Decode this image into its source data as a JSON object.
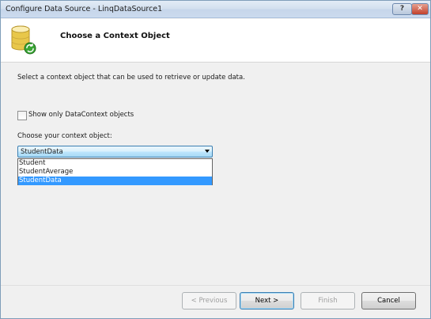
{
  "window": {
    "title": "Configure Data Source - LinqDataSource1",
    "help_label": "?",
    "close_label": "✕"
  },
  "header": {
    "icon": "database-icon",
    "heading": "Choose a Context Object"
  },
  "content": {
    "description": "Select a context object that can be used to retrieve or update data.",
    "checkbox": {
      "label": "Show only DataContext objects",
      "checked": false
    },
    "choose_label": "Choose your context object:",
    "select": {
      "value": "StudentData",
      "options": [
        "Student",
        "StudentAverage",
        "StudentData"
      ]
    }
  },
  "footer": {
    "previous_label": "< Previous",
    "next_label": "Next >",
    "finish_label": "Finish",
    "cancel_label": "Cancel"
  },
  "colors": {
    "selection": "#3399ff",
    "focus_border": "#3c7fb1"
  }
}
